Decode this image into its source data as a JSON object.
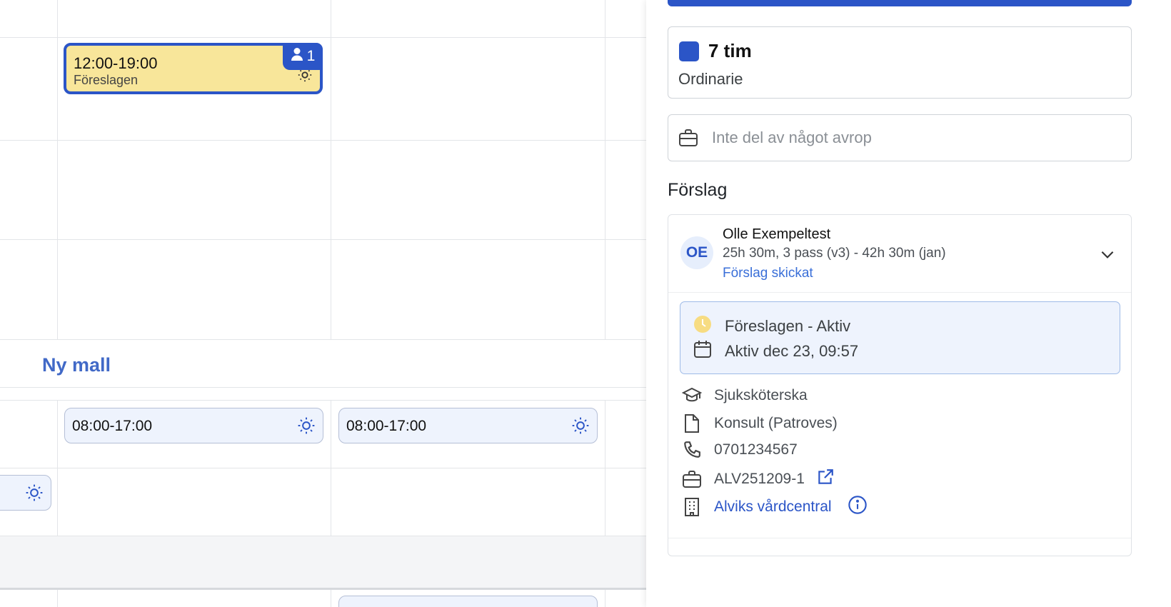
{
  "calendar": {
    "new_template_label": "Ny mall",
    "selected_shift": {
      "time": "12:00-19:00",
      "status": "Föreslagen",
      "assigned_count": "1"
    },
    "shifts": [
      {
        "time": "08:00-17:00"
      },
      {
        "time": "08:00-17:00"
      }
    ]
  },
  "panel": {
    "hours": {
      "value": "7 tim",
      "type": "Ordinarie"
    },
    "avrop": {
      "placeholder": "Inte del av något avrop"
    },
    "section_title": "Förslag",
    "proposal": {
      "initials": "OE",
      "name": "Olle Exempeltest",
      "stats": "25h 30m, 3 pass (v3) - 42h 30m (jan)",
      "status": "Förslag skickat",
      "state": "Föreslagen - Aktiv",
      "active_since": "Aktiv dec 23, 09:57",
      "role": "Sjuksköterska",
      "employment": "Konsult (Patroves)",
      "phone": "0701234567",
      "order_id": "ALV251209-1",
      "unit": "Alviks vårdcentral"
    }
  },
  "colors": {
    "accent": "#2b55c7",
    "proposed_shift": "#f8e69a",
    "shift_bg": "#eef3fd",
    "link": "#3a6fd8",
    "pending_dot": "#f7dc82"
  },
  "icons": [
    "person-icon",
    "sun-icon",
    "briefcase-icon",
    "chevron-down-icon",
    "clock-icon",
    "calendar-icon",
    "graduation-cap-icon",
    "document-icon",
    "phone-icon",
    "external-link-icon",
    "building-icon",
    "info-icon"
  ]
}
